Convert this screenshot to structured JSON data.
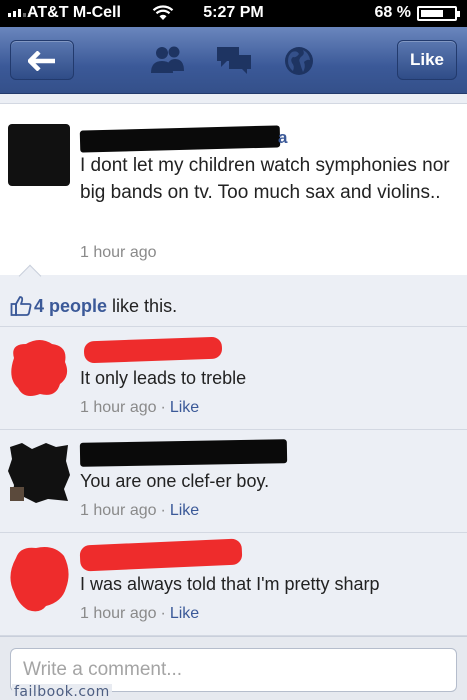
{
  "status_bar": {
    "carrier": "AT&T M-Cell",
    "time": "5:27 PM",
    "battery_percent": "68 %",
    "battery_level": 0.68
  },
  "nav": {
    "back_icon": "back-arrow-icon",
    "friends_icon": "friends-icon",
    "messages_icon": "messages-icon",
    "notifications_icon": "globe-icon",
    "like_label": "Like"
  },
  "post": {
    "author_visible": "a",
    "text": "I dont let my children watch symphonies nor big bands on tv. Too much sax and violins..",
    "time": "1 hour ago"
  },
  "likes": {
    "icon": "thumbs-up-icon",
    "count": "4 people",
    "suffix": "like this."
  },
  "comments": [
    {
      "text": "It only leads to treble",
      "time": "1 hour ago",
      "separator": "·",
      "like": "Like"
    },
    {
      "text": "You are one clef-er boy.",
      "time": "1 hour ago",
      "separator": "·",
      "like": "Like"
    },
    {
      "text": "I was always told that I'm pretty sharp",
      "time": "1 hour ago",
      "separator": "·",
      "like": "Like"
    }
  ],
  "composer": {
    "placeholder": "Write a comment..."
  },
  "watermark": "failbook.com",
  "colors": {
    "brand_blue": "#3b5998",
    "redaction_red": "#ee2c2c",
    "redaction_black": "#0a0a0a"
  }
}
